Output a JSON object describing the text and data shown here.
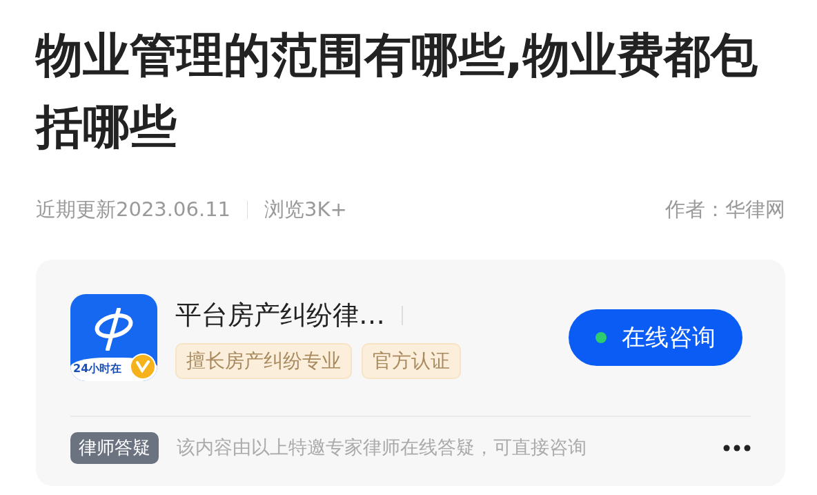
{
  "title": "物业管理的范围有哪些,物业费都包括哪些",
  "meta": {
    "updated": "近期更新2023.06.11",
    "views": "浏览3K+",
    "author": "作者：华律网"
  },
  "card": {
    "logo": {
      "caption": "24小时在",
      "verified": true
    },
    "name": "平台房产纠纷律…",
    "tags": [
      "擅长房产纠纷专业",
      "官方认证"
    ],
    "button": {
      "label": "在线咨询",
      "online": true
    },
    "badge": "律师答疑",
    "note": "该内容由以上特邀专家律师在线答疑，可直接咨询"
  }
}
